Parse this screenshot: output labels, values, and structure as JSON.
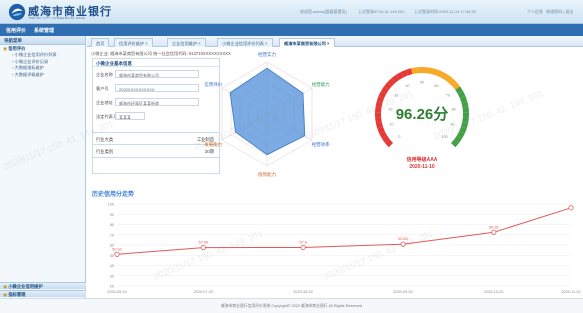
{
  "header": {
    "brand": "威海市商业银行",
    "brand_sub": "WEIHAI CITY COMMERCIAL BANK",
    "info": [
      "欢迎您:admin(超级管理员)",
      "上次登录IP:10.41.149.201",
      "上次登录时间:2020-11-19 17:45:33",
      "个人信息",
      "修改密码 | 退出"
    ]
  },
  "menubar": {
    "items": [
      "信用评价",
      "系统管理"
    ]
  },
  "sidebar": {
    "title": "导航菜单",
    "group": "信用评价",
    "items": [
      "小微企业信用评价列表",
      "小微企业评价记录",
      "大数据指标维护",
      "大数据评级维护"
    ],
    "bottom1": "小微企业信用维护",
    "bottom2": "指标管理"
  },
  "tabs": [
    "首页",
    "信用评价维护",
    "企业信用维护",
    "小微企业信用评价列表",
    "威海市某商贸有限公司"
  ],
  "breadcrumb": "小微企业: 威海市某商贸有限公司 统一社会信用代码: 913710XXXXXXXXXX",
  "info": {
    "title": "小微企业基本信息",
    "fields": [
      {
        "label": "企业名称",
        "value": "威海市某商贸有限公司"
      },
      {
        "label": "客户号",
        "value": "2020XXXXXXXXXX"
      },
      {
        "label": "企业地址",
        "value": "威海市环翠区某某街道"
      },
      {
        "label": "法定代表人",
        "value": "某某某"
      }
    ],
    "industry_label": "行业大类",
    "industry_value": "工业制造",
    "scale_label": "行业类别",
    "scale_value": "30期"
  },
  "radar": {
    "labels": [
      "经营实力",
      "经营能力",
      "经营效率",
      "偿债能力",
      "发展能力",
      "信用评价"
    ]
  },
  "gauge": {
    "value": "96.26分",
    "rating": "信用等级AAA",
    "date": "2020-11-10",
    "ticks": [
      "0",
      "10",
      "20",
      "30",
      "40",
      "50",
      "60",
      "70",
      "80",
      "90",
      "100"
    ]
  },
  "section": {
    "title": "历史信用分走势"
  },
  "chart_data": {
    "type": "line",
    "title": "历史信用分走势",
    "x": [
      "2020-05-10",
      "2020-07-02",
      "2020-08-02",
      "2020-09-02",
      "2020-10-02",
      "2020-11-10"
    ],
    "values": [
      [
        0,
        50.92
      ],
      [
        0.19,
        57.49
      ],
      [
        0.41,
        57.6
      ],
      [
        0.63,
        60.8
      ],
      [
        0.83,
        72.4
      ],
      [
        1.0,
        96.26
      ]
    ],
    "value_labels": [
      "50.92",
      "57.49",
      "57.6",
      "60.83",
      "96.26"
    ],
    "ylim": [
      20,
      100
    ],
    "yticks": [
      "100",
      "90",
      "80",
      "70",
      "60",
      "50",
      "40",
      "30",
      "20"
    ]
  },
  "footer": {
    "text": "威海市商业银行信用评价系统    Copyright© 2020 威海市商业银行 All Rights Reserved"
  },
  "watermark": "2020/11/17 150. 41. 149. 201"
}
